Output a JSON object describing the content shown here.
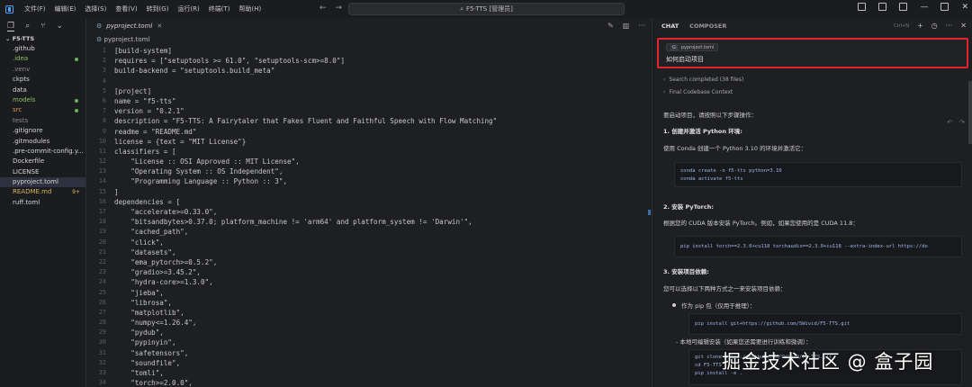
{
  "menu": [
    "文件(F)",
    "编辑(E)",
    "选择(S)",
    "查看(V)",
    "转到(G)",
    "运行(R)",
    "终端(T)",
    "帮助(H)"
  ],
  "window_title": "F5-TTS [管理员]",
  "explorer": {
    "root": "F5-TTS",
    "items": [
      {
        "name": ".github",
        "color": "c-white",
        "badge": ""
      },
      {
        "name": ".idea",
        "color": "c-green",
        "badge": "dot"
      },
      {
        "name": ".venv",
        "color": "c-dim",
        "badge": ""
      },
      {
        "name": "ckpts",
        "color": "c-white",
        "badge": ""
      },
      {
        "name": "data",
        "color": "c-white",
        "badge": ""
      },
      {
        "name": "models",
        "color": "c-green",
        "badge": "dot"
      },
      {
        "name": "src",
        "color": "c-orange",
        "badge": "dot"
      },
      {
        "name": "tests",
        "color": "c-dim",
        "badge": ""
      },
      {
        "name": ".gitignore",
        "color": "c-white",
        "badge": ""
      },
      {
        "name": ".gitmodules",
        "color": "c-white",
        "badge": ""
      },
      {
        "name": ".pre-commit-config.y...",
        "color": "c-white",
        "badge": ""
      },
      {
        "name": "Dockerfile",
        "color": "c-white",
        "badge": ""
      },
      {
        "name": "LICENSE",
        "color": "c-white",
        "badge": ""
      },
      {
        "name": "pyproject.toml",
        "color": "c-white",
        "badge": "",
        "selected": true
      },
      {
        "name": "README.md",
        "color": "c-yellow",
        "badge": "9+"
      },
      {
        "name": "ruff.toml",
        "color": "c-white",
        "badge": ""
      }
    ]
  },
  "editor": {
    "tab_label": "pyproject.toml",
    "breadcrumb": "pyproject.toml",
    "lines": [
      "[build-system]",
      "requires = [\"setuptools >= 61.0\", \"setuptools-scm>=8.0\"]",
      "build-backend = \"setuptools.build_meta\"",
      "",
      "[project]",
      "name = \"f5-tts\"",
      "version = \"0.2.1\"",
      "description = \"F5-TTS: A Fairytaler that Fakes Fluent and Faithful Speech with Flow Matching\"",
      "readme = \"README.md\"",
      "license = {text = \"MIT License\"}",
      "classifiers = [",
      "    \"License :: OSI Approved :: MIT License\",",
      "    \"Operating System :: OS Independent\",",
      "    \"Programming Language :: Python :: 3\",",
      "]",
      "dependencies = [",
      "    \"accelerate>=0.33.0\",",
      "    \"bitsandbytes>0.37.0; platform_machine != 'arm64' and platform_system != 'Darwin'\",",
      "    \"cached_path\",",
      "    \"click\",",
      "    \"datasets\",",
      "    \"ema_pytorch>=0.5.2\",",
      "    \"gradio>=3.45.2\",",
      "    \"hydra-core>=1.3.0\",",
      "    \"jieba\",",
      "    \"librosa\",",
      "    \"matplotlib\",",
      "    \"numpy<=1.26.4\",",
      "    \"pydub\",",
      "    \"pypinyin\",",
      "    \"safetensors\",",
      "    \"soundfile\",",
      "    \"tomli\",",
      "    \"torch>=2.0.0\","
    ]
  },
  "chat": {
    "tabs": [
      "CHAT",
      "COMPOSER"
    ],
    "shortcut": "Ctrl+N",
    "file_pill": "pyproject.toml",
    "query": "如何启动项目",
    "ctx1": "Search completed (38 files)",
    "ctx2": "Final Codebase Context",
    "intro": "要启动项目，请按照以下步骤操作：",
    "step1": "1. 创建并激活 Python 环境:",
    "step1_desc": "使用 Conda 创建一个 Python 3.10 的环境并激活它：",
    "code1": [
      "conda create -n f5-tts python=3.10",
      "conda activate f5-tts"
    ],
    "step2": "2. 安装 PyTorch:",
    "step2_desc": "根据您的 CUDA 版本安装 PyTorch。例如，如果您使用的是 CUDA 11.8：",
    "code2": [
      "pip install torch==2.3.0+cu118 torchaudio==2.3.0+cu118 --extra-index-url https://do"
    ],
    "step3": "3. 安装项目依赖:",
    "step3_desc": "您可以选择以下两种方式之一来安装项目依赖：",
    "bullet1": "作为 pip 包（仅用于推理）：",
    "code3": [
      "pip install git+https://github.com/SWivid/F5-TTS.git"
    ],
    "bullet2": "本地可编辑安装（如果您还需要进行训练和微调）：",
    "code4": [
      "git clone https://github.com/SWivid/F5-TTS.git",
      "cd F5-TTS",
      "pip install -e ."
    ]
  },
  "watermark": "掘金技术社区 @ 盒子园"
}
